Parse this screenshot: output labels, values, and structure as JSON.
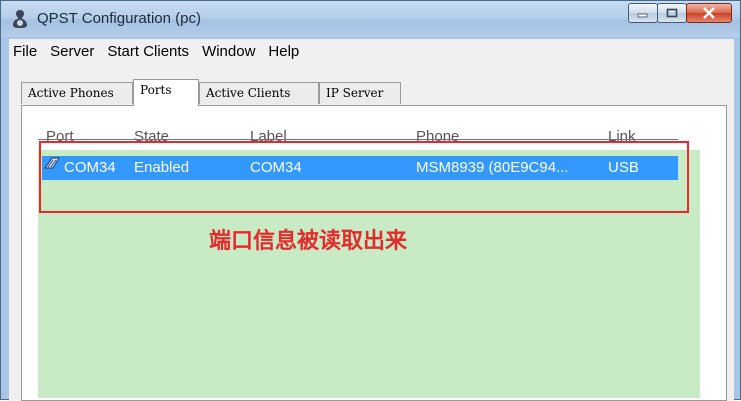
{
  "window": {
    "title": "QPST Configuration (pc)",
    "buttons": {
      "minimize": "—",
      "maximize": "□",
      "close": "✕"
    }
  },
  "menu": [
    "File",
    "Server",
    "Start Clients",
    "Window",
    "Help"
  ],
  "tabs": [
    {
      "label": "Active Phones",
      "active": false
    },
    {
      "label": "Ports",
      "active": true
    },
    {
      "label": "Active Clients",
      "active": false
    },
    {
      "label": "IP Server",
      "active": false
    }
  ],
  "ports_table": {
    "columns": [
      "Port",
      "State",
      "Label",
      "Phone",
      "Link"
    ],
    "rows": [
      {
        "icon": "port-icon",
        "port": "COM34",
        "state": "Enabled",
        "label": "COM34",
        "phone": "MSM8939 (80E9C94...",
        "link": "USB"
      }
    ]
  },
  "annotation": "端口信息被读取出来",
  "colors": {
    "selection": "#3399ff",
    "list_bg": "#c8eac5",
    "annotation": "#e62a2a"
  }
}
